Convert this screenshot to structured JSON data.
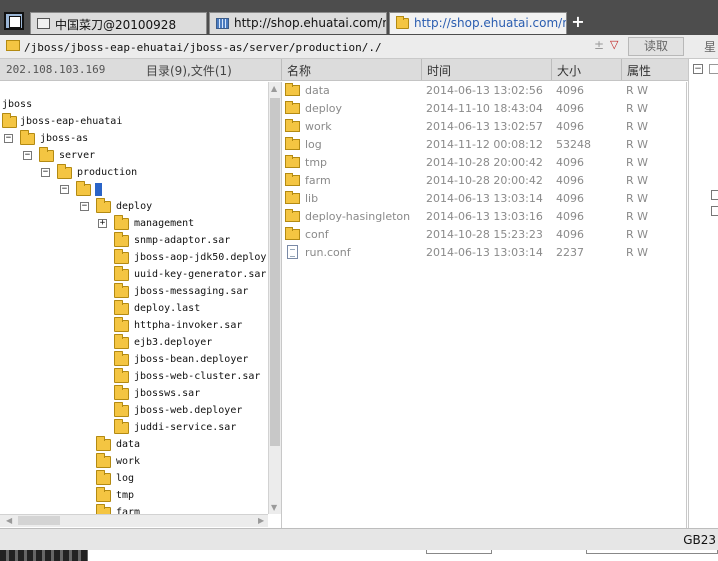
{
  "tabs": [
    {
      "label": "中国菜刀@20100928",
      "icon": "page-icon",
      "active": false
    },
    {
      "label": "http://shop.ehuatai.com/myn...",
      "icon": "image-icon",
      "active": false
    },
    {
      "label": "http://shop.ehuatai.com/myn...",
      "icon": "folder-icon",
      "active": true
    }
  ],
  "new_tab_label": "+",
  "address": {
    "value": "/jboss/jboss-eap-ehuatai/jboss-as/server/production/./",
    "separator": "±",
    "dropdown": "▽",
    "read_button": "读取",
    "star_label": "星"
  },
  "header": {
    "ip": "202.108.103.169",
    "dir_info": "目录(9),文件(1)",
    "columns": {
      "name": "名称",
      "time": "时间",
      "size": "大小",
      "attr": "属性"
    }
  },
  "tree": [
    {
      "label": "jboss",
      "expander": "",
      "folder": false
    },
    {
      "label": "jboss-eap-ehuatai",
      "expander": "",
      "folder": true
    },
    {
      "label": "jboss-as",
      "expander": "−",
      "folder": true
    },
    {
      "label": "server",
      "expander": "−",
      "folder": true
    },
    {
      "label": "production",
      "expander": "−",
      "folder": true
    },
    {
      "label": "",
      "expander": "−",
      "folder": true,
      "selected": true
    },
    {
      "label": "deploy",
      "expander": "−",
      "folder": true
    },
    {
      "label": "management",
      "expander": "+",
      "folder": true
    },
    {
      "label": "snmp-adaptor.sar",
      "expander": "",
      "folder": true
    },
    {
      "label": "jboss-aop-jdk50.deploy",
      "expander": "",
      "folder": true
    },
    {
      "label": "uuid-key-generator.sar",
      "expander": "",
      "folder": true
    },
    {
      "label": "jboss-messaging.sar",
      "expander": "",
      "folder": true
    },
    {
      "label": "deploy.last",
      "expander": "",
      "folder": true
    },
    {
      "label": "httpha-invoker.sar",
      "expander": "",
      "folder": true
    },
    {
      "label": "ejb3.deployer",
      "expander": "",
      "folder": true
    },
    {
      "label": "jboss-bean.deployer",
      "expander": "",
      "folder": true
    },
    {
      "label": "jboss-web-cluster.sar",
      "expander": "",
      "folder": true
    },
    {
      "label": "jbossws.sar",
      "expander": "",
      "folder": true
    },
    {
      "label": "jboss-web.deployer",
      "expander": "",
      "folder": true
    },
    {
      "label": "juddi-service.sar",
      "expander": "",
      "folder": true
    },
    {
      "label": "data",
      "expander": "",
      "folder": true
    },
    {
      "label": "work",
      "expander": "",
      "folder": true
    },
    {
      "label": "log",
      "expander": "",
      "folder": true
    },
    {
      "label": "tmp",
      "expander": "",
      "folder": true
    },
    {
      "label": "farm",
      "expander": "",
      "folder": true
    }
  ],
  "files": [
    {
      "name": "data",
      "time": "2014-06-13 13:02:56",
      "size": "4096",
      "attr": "R W",
      "type": "folder"
    },
    {
      "name": "deploy",
      "time": "2014-11-10 18:43:04",
      "size": "4096",
      "attr": "R W",
      "type": "folder"
    },
    {
      "name": "work",
      "time": "2014-06-13 13:02:57",
      "size": "4096",
      "attr": "R W",
      "type": "folder"
    },
    {
      "name": "log",
      "time": "2014-11-12 00:08:12",
      "size": "53248",
      "attr": "R W",
      "type": "folder"
    },
    {
      "name": "tmp",
      "time": "2014-10-28 20:00:42",
      "size": "4096",
      "attr": "R W",
      "type": "folder"
    },
    {
      "name": "farm",
      "time": "2014-10-28 20:00:42",
      "size": "4096",
      "attr": "R W",
      "type": "folder"
    },
    {
      "name": "lib",
      "time": "2014-06-13 13:03:14",
      "size": "4096",
      "attr": "R W",
      "type": "folder"
    },
    {
      "name": "deploy-hasingleton",
      "time": "2014-06-13 13:03:16",
      "size": "4096",
      "attr": "R W",
      "type": "folder"
    },
    {
      "name": "conf",
      "time": "2014-10-28 15:23:23",
      "size": "4096",
      "attr": "R W",
      "type": "folder"
    },
    {
      "name": "run.conf",
      "time": "2014-06-13 13:03:14",
      "size": "2237",
      "attr": "R W",
      "type": "file"
    }
  ],
  "side_panel": {
    "toggle": "−"
  },
  "status": {
    "encoding": "GB23"
  },
  "colors": {
    "accent": "#2a64c8",
    "folder": "#f4c542",
    "muted_text": "#8a8a8a"
  }
}
